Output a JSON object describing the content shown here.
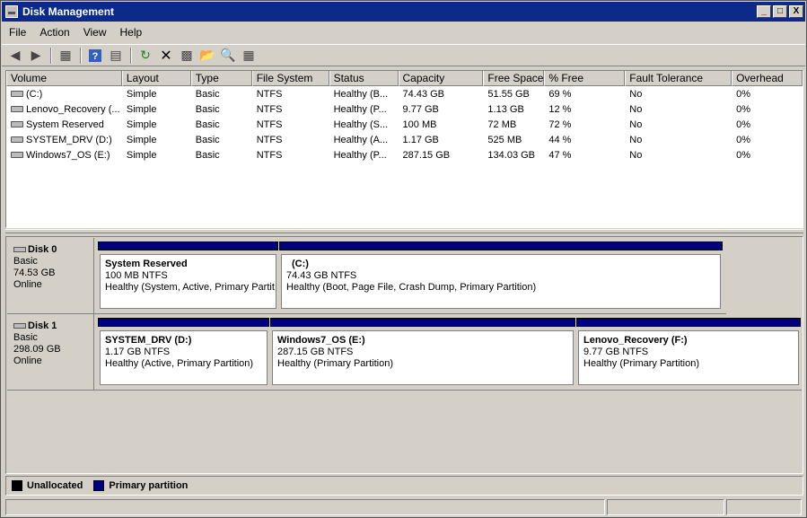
{
  "window": {
    "title": "Disk Management"
  },
  "caption_buttons": [
    "_",
    "□",
    "X"
  ],
  "menu": [
    "File",
    "Action",
    "View",
    "Help"
  ],
  "toolbar": [
    "back-icon",
    "forward-icon",
    "show-hide-tree-icon",
    "help-icon",
    "properties-pane-icon",
    "refresh-icon",
    "delete-icon",
    "properties-icon",
    "open-icon",
    "explore-icon",
    "rescan-icon"
  ],
  "volume_list": {
    "columns": [
      "Volume",
      "Layout",
      "Type",
      "File System",
      "Status",
      "Capacity",
      "Free Space",
      "% Free",
      "Fault Tolerance",
      "Overhead"
    ],
    "rows": [
      [
        "(C:)",
        "Simple",
        "Basic",
        "NTFS",
        "Healthy (B...",
        "74.43 GB",
        "51.55 GB",
        "69 %",
        "No",
        "0%"
      ],
      [
        "Lenovo_Recovery (...",
        "Simple",
        "Basic",
        "NTFS",
        "Healthy (P...",
        "9.77 GB",
        "1.13 GB",
        "12 %",
        "No",
        "0%"
      ],
      [
        "System Reserved",
        "Simple",
        "Basic",
        "NTFS",
        "Healthy (S...",
        "100 MB",
        "72 MB",
        "72 %",
        "No",
        "0%"
      ],
      [
        "SYSTEM_DRV (D:)",
        "Simple",
        "Basic",
        "NTFS",
        "Healthy (A...",
        "1.17 GB",
        "525 MB",
        "44 %",
        "No",
        "0%"
      ],
      [
        "Windows7_OS (E:)",
        "Simple",
        "Basic",
        "NTFS",
        "Healthy (P...",
        "287.15 GB",
        "134.03 GB",
        "47 %",
        "No",
        "0%"
      ]
    ]
  },
  "disks": [
    {
      "name": "Disk 0",
      "type": "Basic",
      "size": "74.53 GB",
      "state": "Online",
      "partitions": [
        {
          "name": "System Reserved",
          "size": "100 MB NTFS",
          "status": "Healthy (System, Active, Primary Partit"
        },
        {
          "name": "(C:)",
          "size": "74.43 GB NTFS",
          "status": "Healthy (Boot, Page File, Crash Dump, Primary Partition)"
        }
      ]
    },
    {
      "name": "Disk 1",
      "type": "Basic",
      "size": "298.09 GB",
      "state": "Online",
      "partitions": [
        {
          "name": "SYSTEM_DRV  (D:)",
          "size": "1.17 GB NTFS",
          "status": "Healthy (Active, Primary Partition)"
        },
        {
          "name": "Windows7_OS  (E:)",
          "size": "287.15 GB NTFS",
          "status": "Healthy (Primary Partition)"
        },
        {
          "name": "Lenovo_Recovery  (F:)",
          "size": "9.77 GB NTFS",
          "status": "Healthy (Primary Partition)"
        }
      ]
    }
  ],
  "legend": [
    {
      "label": "Unallocated",
      "color": "#000000"
    },
    {
      "label": "Primary partition",
      "color": "#00007f"
    }
  ]
}
